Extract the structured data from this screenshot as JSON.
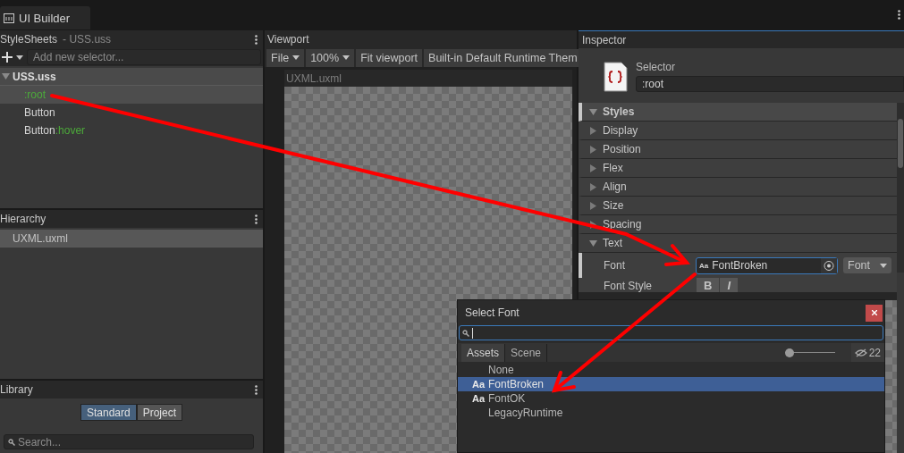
{
  "window_tab": {
    "title": "UI Builder",
    "selected": true
  },
  "stylesheets": {
    "title": "StyleSheets",
    "subtitle": "- USS.uss",
    "selector_placeholder": "Add new selector...",
    "sheet": {
      "name": "USS.uss",
      "expanded": true
    },
    "selectors": [
      {
        "parts": [
          {
            "text": ":root",
            "kind": "pseudo"
          }
        ],
        "selected": true
      },
      {
        "parts": [
          {
            "text": "Button",
            "kind": "type"
          }
        ],
        "selected": false
      },
      {
        "parts": [
          {
            "text": "Button",
            "kind": "type"
          },
          {
            "text": ":hover",
            "kind": "pseudo"
          }
        ],
        "selected": false
      }
    ]
  },
  "hierarchy": {
    "title": "Hierarchy",
    "items": [
      {
        "label": "UXML.uxml",
        "selected": true
      }
    ]
  },
  "library": {
    "title": "Library",
    "tabs": [
      {
        "label": "Standard",
        "selected": true
      },
      {
        "label": "Project",
        "selected": false
      }
    ],
    "search_placeholder": "Search..."
  },
  "viewport": {
    "title": "Viewport",
    "toolbar": [
      {
        "label": "File",
        "kind": "menu"
      },
      {
        "label": "100%",
        "kind": "dropdown"
      },
      {
        "label": "Fit viewport",
        "kind": "button"
      },
      {
        "label": "Built-in Default Runtime Them",
        "kind": "button"
      }
    ],
    "document": "UXML.uxml"
  },
  "inspector": {
    "title": "Inspector",
    "selector_label": "Selector",
    "selector_value": ":root",
    "styles_title": "Styles",
    "sections": [
      {
        "label": "Display",
        "expanded": false
      },
      {
        "label": "Position",
        "expanded": false
      },
      {
        "label": "Flex",
        "expanded": false
      },
      {
        "label": "Align",
        "expanded": false
      },
      {
        "label": "Size",
        "expanded": false
      },
      {
        "label": "Spacing",
        "expanded": false
      },
      {
        "label": "Text",
        "expanded": true
      }
    ],
    "font": {
      "label": "Font",
      "badge": "Aa",
      "value": "FontBroken",
      "mode": "Font"
    },
    "font_style": {
      "label": "Font Style",
      "buttons": [
        "B",
        "I"
      ]
    }
  },
  "font_picker": {
    "title": "Select Font",
    "tabs": [
      {
        "label": "Assets",
        "selected": true
      },
      {
        "label": "Scene",
        "selected": false
      }
    ],
    "zoom": {
      "level": 0
    },
    "hidden_count": "22",
    "items": [
      {
        "label": "None",
        "selected": false
      },
      {
        "label": "FontBroken",
        "badge": "Aa",
        "selected": true
      },
      {
        "label": "FontOK",
        "badge": "Aa",
        "selected": false
      },
      {
        "label": "LegacyRuntime",
        "selected": false
      }
    ]
  }
}
